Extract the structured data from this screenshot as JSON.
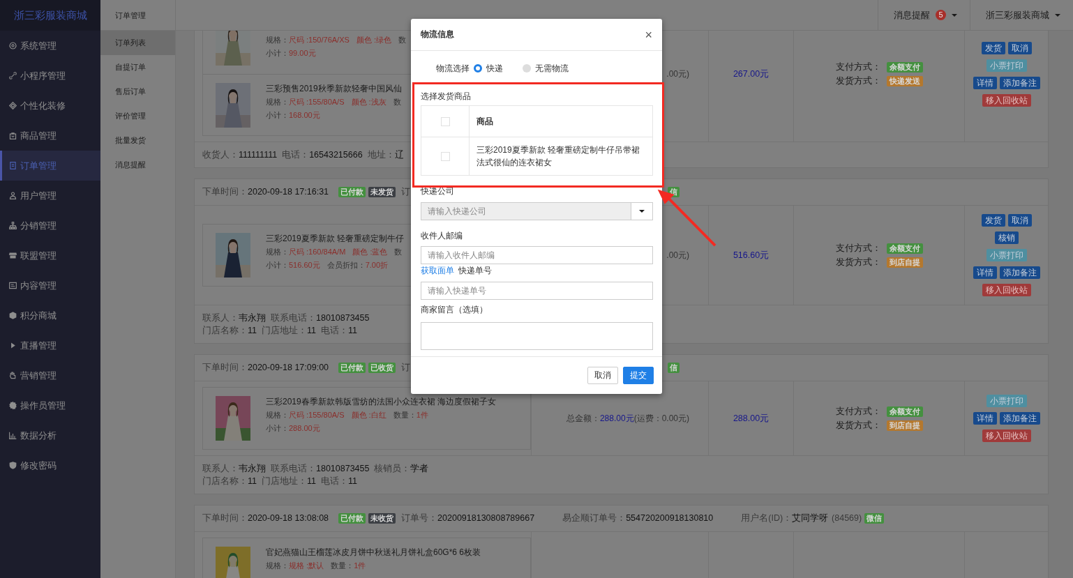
{
  "sidebar": {
    "logo": "浙三彩服装商城",
    "items": [
      {
        "label": "系统管理",
        "selected": false
      },
      {
        "label": "小程序管理",
        "selected": false
      },
      {
        "label": "个性化装修",
        "selected": false
      },
      {
        "label": "商品管理",
        "selected": false
      },
      {
        "label": "订单管理",
        "selected": true
      },
      {
        "label": "用户管理",
        "selected": false
      },
      {
        "label": "分销管理",
        "selected": false
      },
      {
        "label": "联盟管理",
        "selected": false
      },
      {
        "label": "内容管理",
        "selected": false
      },
      {
        "label": "积分商城",
        "selected": false
      },
      {
        "label": "直播管理",
        "selected": false
      },
      {
        "label": "营销管理",
        "selected": false
      },
      {
        "label": "操作员管理",
        "selected": false
      },
      {
        "label": "数据分析",
        "selected": false
      },
      {
        "label": "修改密码",
        "selected": false
      }
    ]
  },
  "subnav": {
    "title": "订单管理",
    "items": [
      {
        "label": "订单列表",
        "selected": true
      },
      {
        "label": "自提订单",
        "selected": false
      },
      {
        "label": "售后订单",
        "selected": false
      },
      {
        "label": "评价管理",
        "selected": false
      },
      {
        "label": "批量发货",
        "selected": false
      },
      {
        "label": "消息提醒",
        "selected": false
      }
    ]
  },
  "topbar": {
    "notice_label": "消息提醒",
    "notice_count": "5",
    "account": "浙三彩服装商城"
  },
  "orders": [
    {
      "items": [
        {
          "lines": [
            [
              {
                "text": "规格：",
                "kind": "label"
              },
              {
                "text": "尺码 :150/76A/XS",
                "kind": "value"
              },
              {
                "text": "颜色 :绿色",
                "kind": "value"
              },
              {
                "text": "数",
                "kind": "label"
              }
            ],
            [
              {
                "text": "小计：",
                "kind": "label"
              },
              {
                "text": "99.00元",
                "kind": "value"
              }
            ]
          ]
        },
        {
          "title": "三彩预售2019秋季新款轻奢中国风仙",
          "lines": [
            [
              {
                "text": "规格：",
                "kind": "label"
              },
              {
                "text": "尺码 :155/80A/S",
                "kind": "value"
              },
              {
                "text": "颜色 :浅灰",
                "kind": "value"
              },
              {
                "text": "数",
                "kind": "label"
              }
            ],
            [
              {
                "text": "小计：",
                "kind": "label"
              },
              {
                "text": "168.00元",
                "kind": "value"
              }
            ]
          ]
        }
      ],
      "total": [
        {
          "text": ".00元)",
          "kind": "label"
        }
      ],
      "paid": "267.00元",
      "payment": [
        {
          "label": "支付方式：",
          "tag": "余额支付",
          "color": "#44903f"
        },
        {
          "label": "发货方式：",
          "tag": "快递发送",
          "color": "#b4782e"
        }
      ],
      "actions": [
        [
          {
            "label": "发货",
            "kind": "primary"
          },
          {
            "label": "取消",
            "kind": "primary"
          }
        ],
        [
          {
            "label": "小票打印",
            "kind": "info"
          }
        ],
        [
          {
            "label": "详情",
            "kind": "primary"
          },
          {
            "label": "添加备注",
            "kind": "primary"
          }
        ],
        [
          {
            "label": "移入回收站",
            "kind": "danger"
          }
        ]
      ],
      "footer": [
        [
          {
            "label": "收货人：",
            "value": "111111111"
          },
          {
            "label": "电话：",
            "value": "16543215666"
          },
          {
            "label": "地址：",
            "value": "辽"
          }
        ]
      ]
    },
    {
      "header": {
        "kind": "covered",
        "time_label": "下单时间：",
        "time": "2020-09-18 17:16:31",
        "tags": [
          {
            "text": "已付款",
            "color": "#44903f"
          },
          {
            "text": "未发货",
            "color": "#3c3f44"
          }
        ],
        "fields": [
          {
            "label": "订"
          }
        ],
        "end_tags": [
          {
            "text": "信",
            "color": "#44903f"
          }
        ]
      },
      "items": [
        {
          "title": "三彩2019夏季新款 轻奢重磅定制牛仔",
          "lines": [
            [
              {
                "text": "规格：",
                "kind": "label"
              },
              {
                "text": "尺码 :160/84A/M",
                "kind": "value"
              },
              {
                "text": "颜色 :蓝色",
                "kind": "value"
              },
              {
                "text": "数",
                "kind": "label"
              }
            ],
            [
              {
                "text": "小计：",
                "kind": "label"
              },
              {
                "text": "516.60元",
                "kind": "value"
              },
              {
                "text": "会员折扣：",
                "kind": "label"
              },
              {
                "text": "7.00折",
                "kind": "value"
              }
            ]
          ]
        }
      ],
      "total": [
        {
          "text": ".00元)",
          "kind": "label"
        }
      ],
      "paid": "516.60元",
      "payment": [
        {
          "label": "支付方式：",
          "tag": "余额支付",
          "color": "#44903f"
        },
        {
          "label": "发货方式：",
          "tag": "到店自提",
          "color": "#b4782e"
        }
      ],
      "actions": [
        [
          {
            "label": "发货",
            "kind": "primary"
          },
          {
            "label": "取消",
            "kind": "primary"
          }
        ],
        [
          {
            "label": "核销",
            "kind": "primary"
          }
        ],
        [
          {
            "label": "小票打印",
            "kind": "info"
          }
        ],
        [
          {
            "label": "详情",
            "kind": "primary"
          },
          {
            "label": "添加备注",
            "kind": "primary"
          }
        ],
        [
          {
            "label": "移入回收站",
            "kind": "danger"
          }
        ]
      ],
      "footer": [
        [
          {
            "label": "联系人：",
            "value": "韦永翔"
          },
          {
            "label": "联系电话：",
            "value": "18010873455"
          }
        ],
        [
          {
            "label": "门店名称：",
            "value": "11"
          },
          {
            "label": "门店地址：",
            "value": "11"
          },
          {
            "label": "电话：",
            "value": "11"
          }
        ]
      ]
    },
    {
      "header": {
        "kind": "covered",
        "time_label": "下单时间：",
        "time": "2020-09-18 17:09:00",
        "tags": [
          {
            "text": "已付款",
            "color": "#44903f"
          },
          {
            "text": "已收货",
            "color": "#44903f"
          }
        ],
        "fields": [
          {
            "label": "订"
          }
        ],
        "end_tags": [
          {
            "text": "信",
            "color": "#44903f"
          }
        ]
      },
      "items": [
        {
          "title": "三彩2019春季新款韩版雪纺的法国小众连衣裙 海边度假裙子女",
          "lines": [
            [
              {
                "text": "规格：",
                "kind": "label"
              },
              {
                "text": "尺码 :155/80A/S",
                "kind": "value"
              },
              {
                "text": "颜色 :白红",
                "kind": "value"
              },
              {
                "text": "数量：",
                "kind": "label"
              },
              {
                "text": "1件",
                "kind": "value"
              }
            ],
            [
              {
                "text": "小计：",
                "kind": "label"
              },
              {
                "text": "288.00元",
                "kind": "value"
              }
            ]
          ]
        }
      ],
      "total": [
        {
          "text": "总金额：",
          "kind": "label"
        },
        {
          "text": "288.00元",
          "kind": "amount"
        },
        {
          "text": "(运费：0.00元)",
          "kind": "label"
        }
      ],
      "paid": "288.00元",
      "payment": [
        {
          "label": "支付方式：",
          "tag": "余额支付",
          "color": "#44903f"
        },
        {
          "label": "发货方式：",
          "tag": "到店自提",
          "color": "#b4782e"
        }
      ],
      "actions": [
        [
          {
            "label": "小票打印",
            "kind": "info"
          }
        ],
        [
          {
            "label": "详情",
            "kind": "primary"
          },
          {
            "label": "添加备注",
            "kind": "primary"
          }
        ],
        [
          {
            "label": "移入回收站",
            "kind": "danger"
          }
        ]
      ],
      "footer": [
        [
          {
            "label": "联系人：",
            "value": "韦永翔"
          },
          {
            "label": "联系电话：",
            "value": "18010873455"
          },
          {
            "label": "核销员：",
            "value": "学者"
          }
        ],
        [
          {
            "label": "门店名称：",
            "value": "11"
          },
          {
            "label": "门店地址：",
            "value": "11"
          },
          {
            "label": "电话：",
            "value": "11"
          }
        ]
      ]
    },
    {
      "header": {
        "kind": "full",
        "time_label": "下单时间：",
        "time": "2020-09-18 13:08:08",
        "tags": [
          {
            "text": "已付款",
            "color": "#44903f"
          },
          {
            "text": "未收货",
            "color": "#3c3f44"
          }
        ],
        "fields": [
          {
            "label": "订单号：",
            "value": "20200918130808789667"
          },
          {
            "label": "易企顺订单号：",
            "value": "554720200918130810"
          },
          {
            "label": "用户名(ID)：",
            "value": "艾同学呀",
            "note": "(84569)"
          }
        ],
        "end_tags": [
          {
            "text": "微信",
            "color": "#44903f"
          }
        ]
      },
      "items": [
        {
          "title": "官妃燕猫山王榴莲冰皮月饼中秋送礼月饼礼盒60G*6 6枚装",
          "lines": [
            [
              {
                "text": "规格：",
                "kind": "label"
              },
              {
                "text": "规格 :默认",
                "kind": "value"
              },
              {
                "text": "数量：",
                "kind": "label"
              },
              {
                "text": "1件",
                "kind": "value"
              }
            ]
          ]
        }
      ]
    }
  ],
  "modal": {
    "title": "物流信息",
    "close": "×",
    "logistics_label": "物流选择",
    "options": [
      {
        "label": "快递",
        "selected": true
      },
      {
        "label": "无需物流",
        "selected": false
      }
    ],
    "goods_label": "选择发货商品",
    "goods_table": {
      "header_checked": false,
      "column": "商品",
      "rows": [
        {
          "checked": false,
          "name": "三彩2019夏季新款 轻奢重磅定制牛仔吊带裙法式很仙的连衣裙女"
        }
      ]
    },
    "company_label": "快递公司",
    "company_placeholder": "请输入快递公司",
    "zip_label": "收件人邮编",
    "zip_placeholder": "请输入收件人邮编",
    "waybill_link": "获取面单",
    "tracking_label": "快递单号",
    "tracking_placeholder": "请输入快递单号",
    "note_label": "商家留言（选填）",
    "buttons": [
      {
        "label": "取消",
        "kind": "default"
      },
      {
        "label": "提交",
        "kind": "primary"
      }
    ]
  }
}
